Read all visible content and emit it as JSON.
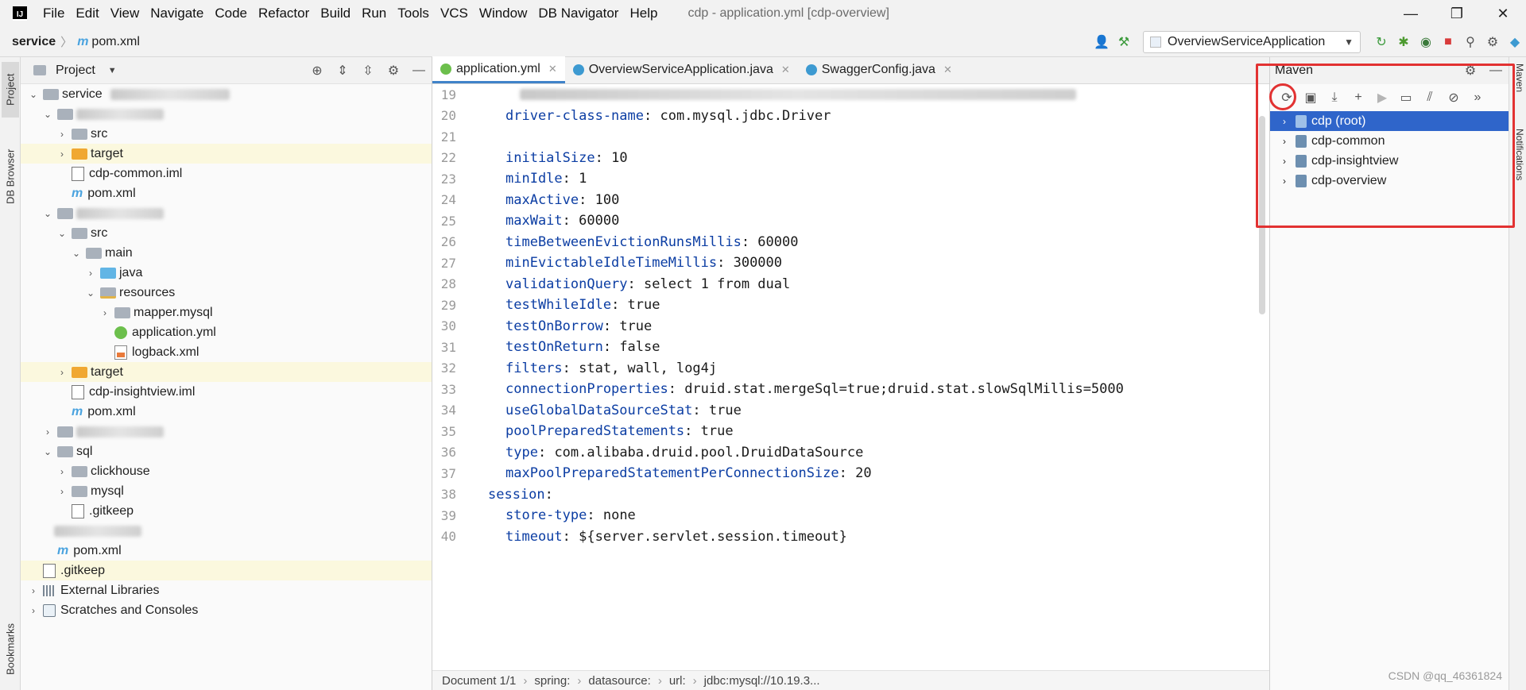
{
  "menubar": {
    "items": [
      "File",
      "Edit",
      "View",
      "Navigate",
      "Code",
      "Refactor",
      "Build",
      "Run",
      "Tools",
      "VCS",
      "Window",
      "DB Navigator",
      "Help"
    ],
    "window_title": "cdp - application.yml [cdp-overview]",
    "min": "—",
    "max": "❐",
    "close": "✕"
  },
  "navbar": {
    "root": "service",
    "file": "pom.xml",
    "maven_glyph": "m",
    "run_config": "OverviewServiceApplication"
  },
  "left_strip": {
    "project_tab": "Project",
    "db_browser_tab": "DB Browser",
    "bookmarks_tab": "Bookmarks"
  },
  "right_strip": {
    "maven_tab": "Maven",
    "notifications_tab": "Notifications"
  },
  "project_panel": {
    "title": "Project",
    "tree": [
      {
        "label": "service",
        "suffix": "D:\\...\\cdp\\service",
        "indent": 0,
        "chev": "v",
        "icon": "folder-gray",
        "hl": false
      },
      {
        "label": "",
        "indent": 1,
        "chev": "v",
        "icon": "folder-gray",
        "hl": false,
        "blurred": true
      },
      {
        "label": "src",
        "indent": 2,
        "chev": ">",
        "icon": "folder-gray",
        "hl": false
      },
      {
        "label": "target",
        "indent": 2,
        "chev": ">",
        "icon": "folder-orange",
        "hl": true
      },
      {
        "label": "cdp-common.iml",
        "indent": 2,
        "chev": "",
        "icon": "file",
        "hl": false
      },
      {
        "label": "pom.xml",
        "indent": 2,
        "chev": "",
        "icon": "maven",
        "hl": false
      },
      {
        "label": "",
        "indent": 1,
        "chev": "v",
        "icon": "folder-gray",
        "hl": false,
        "blurred": true
      },
      {
        "label": "src",
        "indent": 2,
        "chev": "v",
        "icon": "folder-gray",
        "hl": false
      },
      {
        "label": "main",
        "indent": 3,
        "chev": "v",
        "icon": "folder-gray",
        "hl": false
      },
      {
        "label": "java",
        "indent": 4,
        "chev": ">",
        "icon": "folder-blue",
        "hl": false
      },
      {
        "label": "resources",
        "indent": 4,
        "chev": "v",
        "icon": "folder-res",
        "hl": false
      },
      {
        "label": "mapper.mysql",
        "indent": 5,
        "chev": ">",
        "icon": "folder-gray",
        "hl": false
      },
      {
        "label": "application.yml",
        "indent": 5,
        "chev": "",
        "icon": "yml",
        "hl": false
      },
      {
        "label": "logback.xml",
        "indent": 5,
        "chev": "",
        "icon": "xml",
        "hl": false
      },
      {
        "label": "target",
        "indent": 2,
        "chev": ">",
        "icon": "folder-orange",
        "hl": true
      },
      {
        "label": "cdp-insightview.iml",
        "indent": 2,
        "chev": "",
        "icon": "file",
        "hl": false
      },
      {
        "label": "pom.xml",
        "indent": 2,
        "chev": "",
        "icon": "maven",
        "hl": false
      },
      {
        "label": "",
        "indent": 1,
        "chev": ">",
        "icon": "folder-gray",
        "hl": false,
        "blurred": true
      },
      {
        "label": "sql",
        "indent": 1,
        "chev": "v",
        "icon": "folder-gray",
        "hl": false
      },
      {
        "label": "clickhouse",
        "indent": 2,
        "chev": ">",
        "icon": "folder-gray",
        "hl": false
      },
      {
        "label": "mysql",
        "indent": 2,
        "chev": ">",
        "icon": "folder-gray",
        "hl": false
      },
      {
        "label": ".gitkeep",
        "indent": 2,
        "chev": "",
        "icon": "file",
        "hl": false
      },
      {
        "label": "",
        "indent": 1,
        "chev": "",
        "icon": "none",
        "hl": false,
        "blurred": true
      },
      {
        "label": "pom.xml",
        "indent": 1,
        "chev": "",
        "icon": "maven",
        "hl": false
      },
      {
        "label": ".gitkeep",
        "indent": 0,
        "chev": "",
        "icon": "file",
        "hl": true
      },
      {
        "label": "External Libraries",
        "indent": 0,
        "chev": ">",
        "icon": "lib",
        "hl": false
      },
      {
        "label": "Scratches and Consoles",
        "indent": 0,
        "chev": ">",
        "icon": "scratch",
        "hl": false
      }
    ]
  },
  "editor": {
    "tabs": [
      {
        "label": "application.yml",
        "color": "#6cbf4c",
        "active": true
      },
      {
        "label": "OverviewServiceApplication.java",
        "color": "#3d9ad1",
        "active": false
      },
      {
        "label": "SwaggerConfig.java",
        "color": "#3d9ad1",
        "active": false
      }
    ],
    "lines": [
      {
        "n": "19",
        "key": "",
        "val": "",
        "indent": 0,
        "blurred": true
      },
      {
        "n": "20",
        "key": "driver-class-name",
        "val": " com.mysql.jdbc.Driver",
        "indent": 1
      },
      {
        "n": "21",
        "key": "",
        "val": "",
        "indent": 1
      },
      {
        "n": "22",
        "key": "initialSize",
        "val": " 10",
        "indent": 1
      },
      {
        "n": "23",
        "key": "minIdle",
        "val": " 1",
        "indent": 1
      },
      {
        "n": "24",
        "key": "maxActive",
        "val": " 100",
        "indent": 1
      },
      {
        "n": "25",
        "key": "maxWait",
        "val": " 60000",
        "indent": 1
      },
      {
        "n": "26",
        "key": "timeBetweenEvictionRunsMillis",
        "val": " 60000",
        "indent": 1
      },
      {
        "n": "27",
        "key": "minEvictableIdleTimeMillis",
        "val": " 300000",
        "indent": 1
      },
      {
        "n": "28",
        "key": "validationQuery",
        "val": " select 1 from dual",
        "indent": 1
      },
      {
        "n": "29",
        "key": "testWhileIdle",
        "val": " true",
        "indent": 1
      },
      {
        "n": "30",
        "key": "testOnBorrow",
        "val": " true",
        "indent": 1
      },
      {
        "n": "31",
        "key": "testOnReturn",
        "val": " false",
        "indent": 1
      },
      {
        "n": "32",
        "key": "filters",
        "val": " stat, wall, log4j",
        "indent": 1
      },
      {
        "n": "33",
        "key": "connectionProperties",
        "val": " druid.stat.mergeSql=true;druid.stat.slowSqlMillis=5000",
        "indent": 1
      },
      {
        "n": "34",
        "key": "useGlobalDataSourceStat",
        "val": " true",
        "indent": 1
      },
      {
        "n": "35",
        "key": "poolPreparedStatements",
        "val": " true",
        "indent": 1
      },
      {
        "n": "36",
        "key": "type",
        "val": " com.alibaba.druid.pool.DruidDataSource",
        "indent": 1
      },
      {
        "n": "37",
        "key": "maxPoolPreparedStatementPerConnectionSize",
        "val": " 20",
        "indent": 1
      },
      {
        "n": "38",
        "key": "session",
        "val": "",
        "indent": 0
      },
      {
        "n": "39",
        "key": "store-type",
        "val": " none",
        "indent": 1
      },
      {
        "n": "40",
        "key": "timeout",
        "val": " ${server.servlet.session.timeout}",
        "indent": 1
      }
    ],
    "status": [
      "Document 1/1",
      "spring:",
      "datasource:",
      "url:",
      "jdbc:mysql://10.19.3..."
    ]
  },
  "maven_panel": {
    "title": "Maven",
    "projects": [
      {
        "label": "cdp (root)",
        "selected": true
      },
      {
        "label": "cdp-common",
        "selected": false
      },
      {
        "label": "cdp-insightview",
        "selected": false
      },
      {
        "label": "cdp-overview",
        "selected": false
      }
    ]
  },
  "watermark": "CSDN @qq_46361824",
  "colors": {
    "annotation_red": "#e23232",
    "selection_blue": "#2f65ca",
    "yaml_key": "#0b3da3",
    "highlight_row": "#fbf8de"
  }
}
